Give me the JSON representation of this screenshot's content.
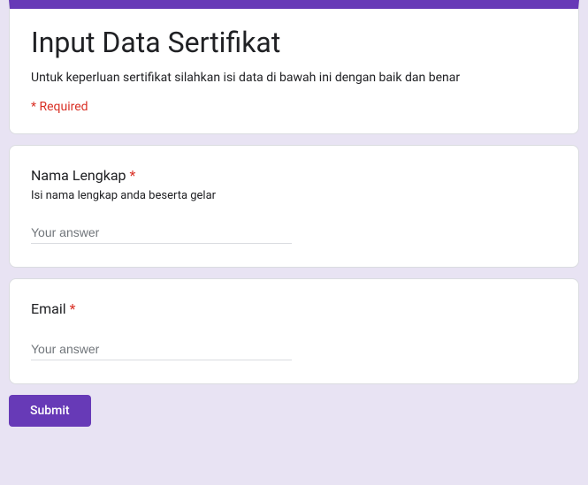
{
  "header": {
    "title": "Input Data Sertifikat",
    "description": "Untuk keperluan sertifikat silahkan isi data di bawah ini dengan baik dan benar",
    "required_note": "* Required"
  },
  "questions": [
    {
      "label": "Nama Lengkap",
      "required_star": "*",
      "description": "Isi nama lengkap anda beserta gelar",
      "placeholder": "Your answer"
    },
    {
      "label": "Email",
      "required_star": "*",
      "placeholder": "Your answer"
    }
  ],
  "submit_label": "Submit"
}
